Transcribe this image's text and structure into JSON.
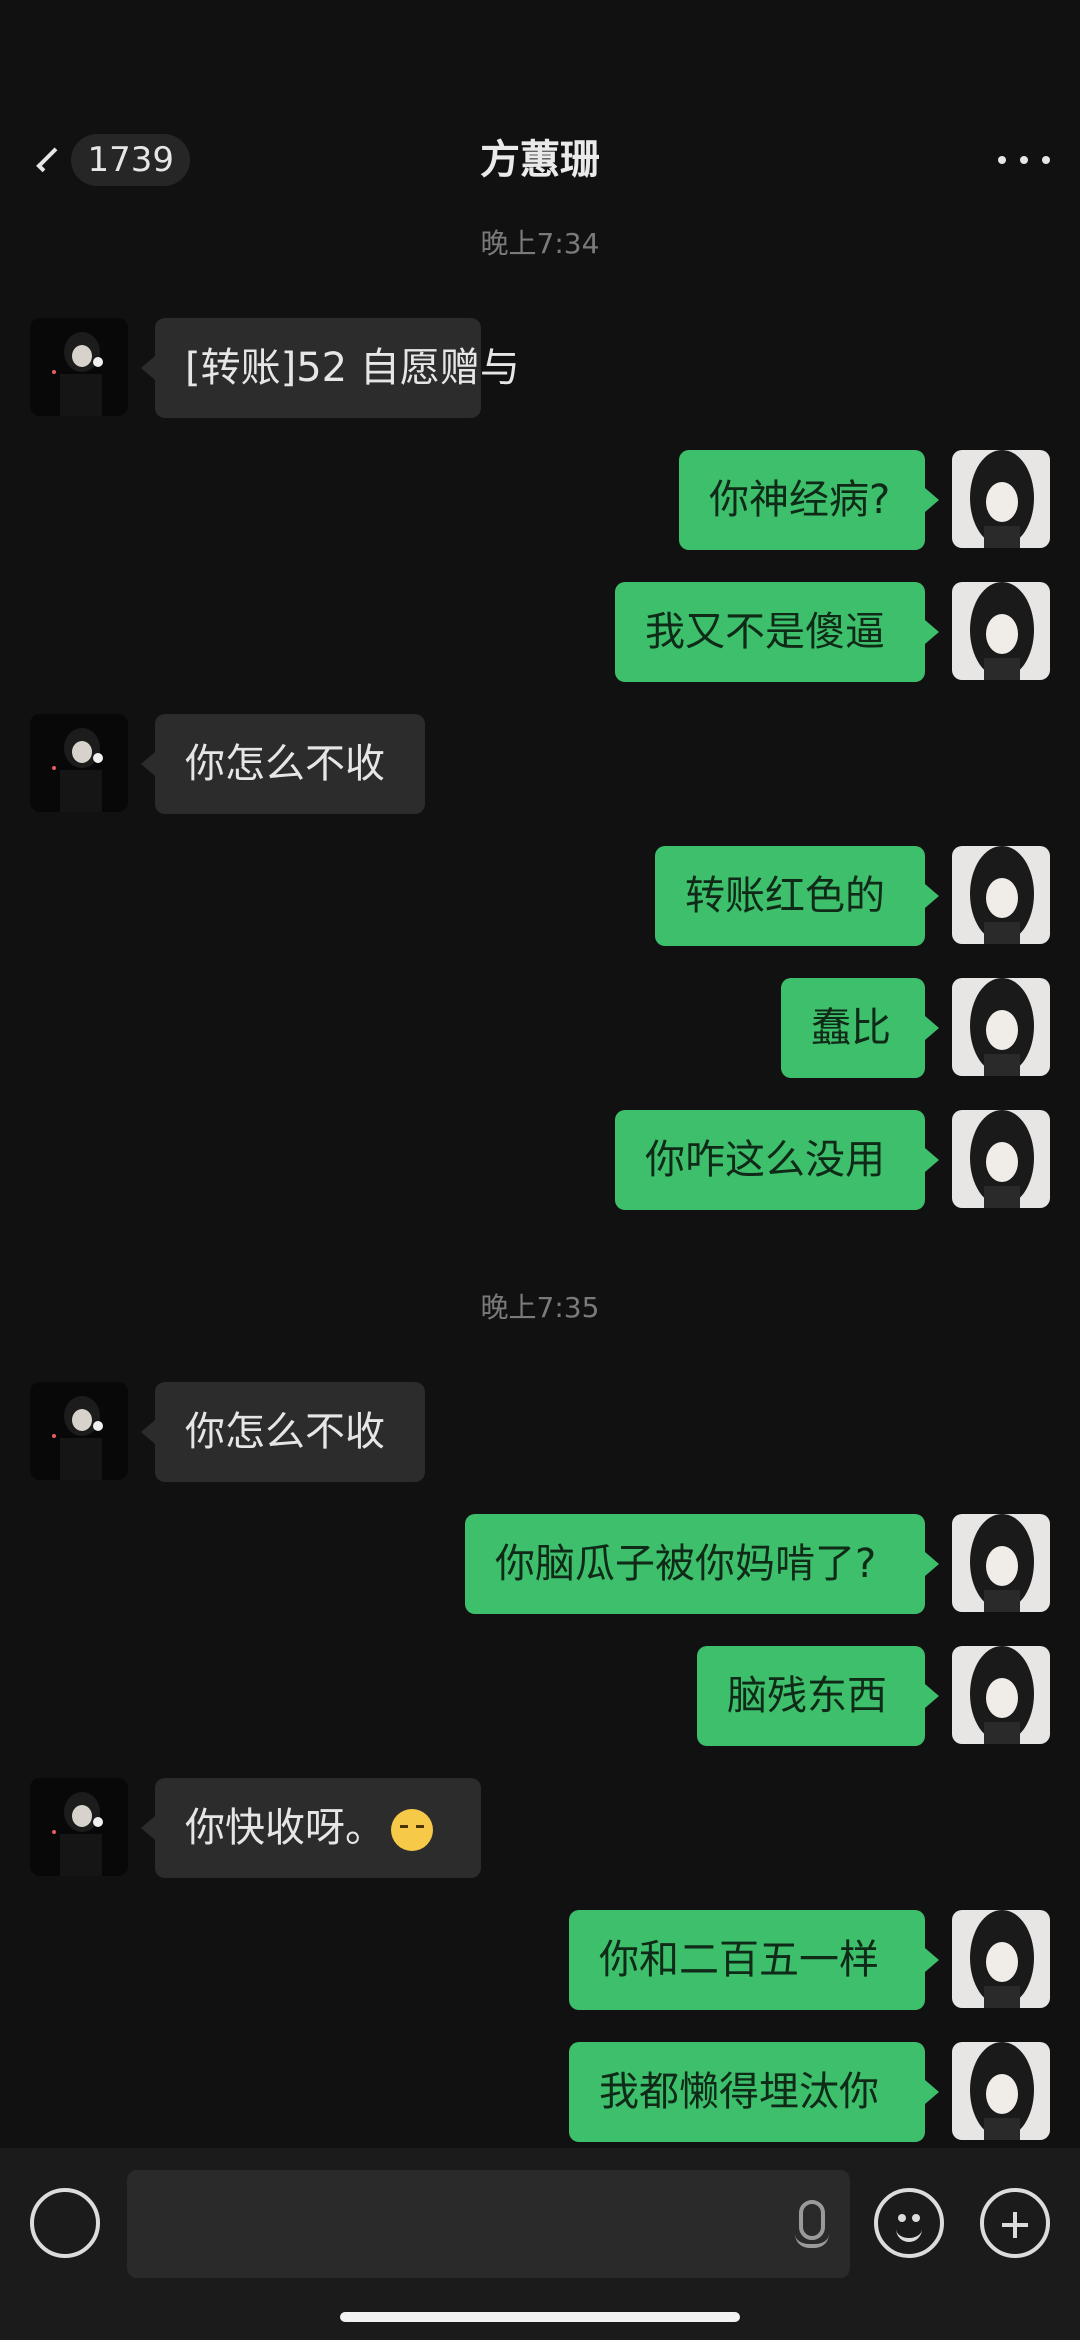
{
  "header": {
    "unread_count": "1739",
    "title": "方蕙珊"
  },
  "messages": {
    "t1": "晚上7:34",
    "m1": "[转账]52 自愿赠与",
    "m2": "你神经病?",
    "m3": "我又不是傻逼",
    "m4": "你怎么不收",
    "m5": "转账红色的",
    "m6": "蠢比",
    "m7": "你咋这么没用",
    "t2": "晚上7:35",
    "m8": "你怎么不收",
    "m9": "你脑瓜子被你妈啃了?",
    "m10": "脑残东西",
    "m11": "你快收呀。",
    "m12": "你和二百五一样",
    "m13": "我都懒得埋汰你"
  },
  "icons": {
    "back": "chevron-left-icon",
    "more": "more-icon",
    "voice": "voice-icon",
    "mic": "mic-icon",
    "emoji": "emoji-icon",
    "plus": "plus-icon",
    "crying_emoji": "crying-face-emoji"
  },
  "colors": {
    "background": "#111111",
    "outgoing_bubble": "#3dbf6c",
    "incoming_bubble": "#2c2c2c"
  }
}
